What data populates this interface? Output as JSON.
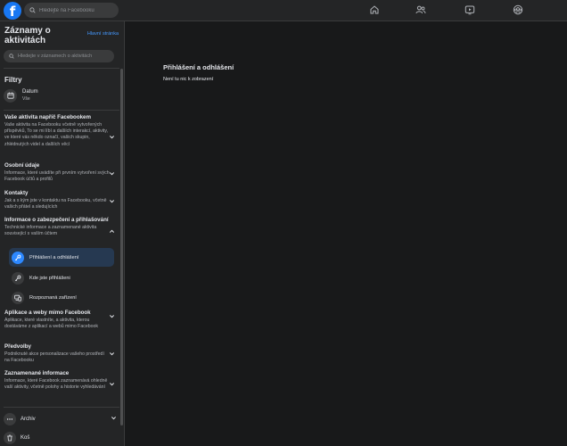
{
  "topbar": {
    "logo_letter": "f",
    "search_placeholder": "Hledejte na Facebooku",
    "nav_icons": [
      "home-icon",
      "friends-icon",
      "watch-icon",
      "groups-icon"
    ]
  },
  "sidebar": {
    "title": "Záznamy o aktivitách",
    "home_link": "Hlavní stránka",
    "search_placeholder": "Hledejte v záznamech o aktivitách",
    "filters_heading": "Filtry",
    "date_filter": {
      "label": "Datum",
      "value": "Vše"
    },
    "sections": [
      {
        "title": "Vaše aktivita napříč Facebookem",
        "description": "Vaše aktivita na Facebooku včetně vytvořených příspěvků, To se mi líbí a dalších interakcí, aktivity, ve které vás někdo označí, vašich skupin, zhlédnutých videí a dalších věcí",
        "expanded": false
      },
      {
        "title": "Osobní údaje",
        "description": "Informace, které uvádíte při prvním vytvoření svých Facebook účtů a profilů",
        "expanded": false
      },
      {
        "title": "Kontakty",
        "description": "Jak a s kým jste v kontaktu na Facebooku, včetně vašich přátel a sledujících",
        "expanded": false
      },
      {
        "title": "Informace o zabezpečení a přihlašování",
        "description": "Technické informace a zaznamenané aktivita související s vaším účtem",
        "expanded": true,
        "items": [
          {
            "label": "Přihlášení a odhlášení",
            "icon": "key-icon",
            "active": true
          },
          {
            "label": "Kde jste přihlášeni",
            "icon": "key-icon",
            "active": false
          },
          {
            "label": "Rozpoznaná zařízení",
            "icon": "devices-icon",
            "active": false
          }
        ]
      },
      {
        "title": "Aplikace a weby mimo Facebook",
        "description": "Aplikace, které vlastníte, a aktivita, kterou dostáváme z aplikací a webů mimo Facebook",
        "expanded": false
      },
      {
        "title": "Předvolby",
        "description": "Podniknuté akce personalizace vašeho prostředí na Facebooku",
        "expanded": false
      },
      {
        "title": "Zaznamenané informace",
        "description": "Informace, které Facebook zaznamenává ohledně vaší aktivity, včetně polohy a historie vyhledávání",
        "expanded": false
      }
    ],
    "bottom": [
      {
        "label": "Archiv",
        "icon": "more-icon",
        "has_chevron": true
      },
      {
        "label": "Koš",
        "icon": "trash-icon",
        "has_chevron": false
      }
    ]
  },
  "main": {
    "title": "Přihlášení a odhlášení",
    "empty_message": "Není tu nic k zobrazení"
  },
  "colors": {
    "background": "#18191a",
    "surface": "#242526",
    "accent": "#1877f2",
    "active_item": "#263951",
    "link": "#4599ff"
  }
}
